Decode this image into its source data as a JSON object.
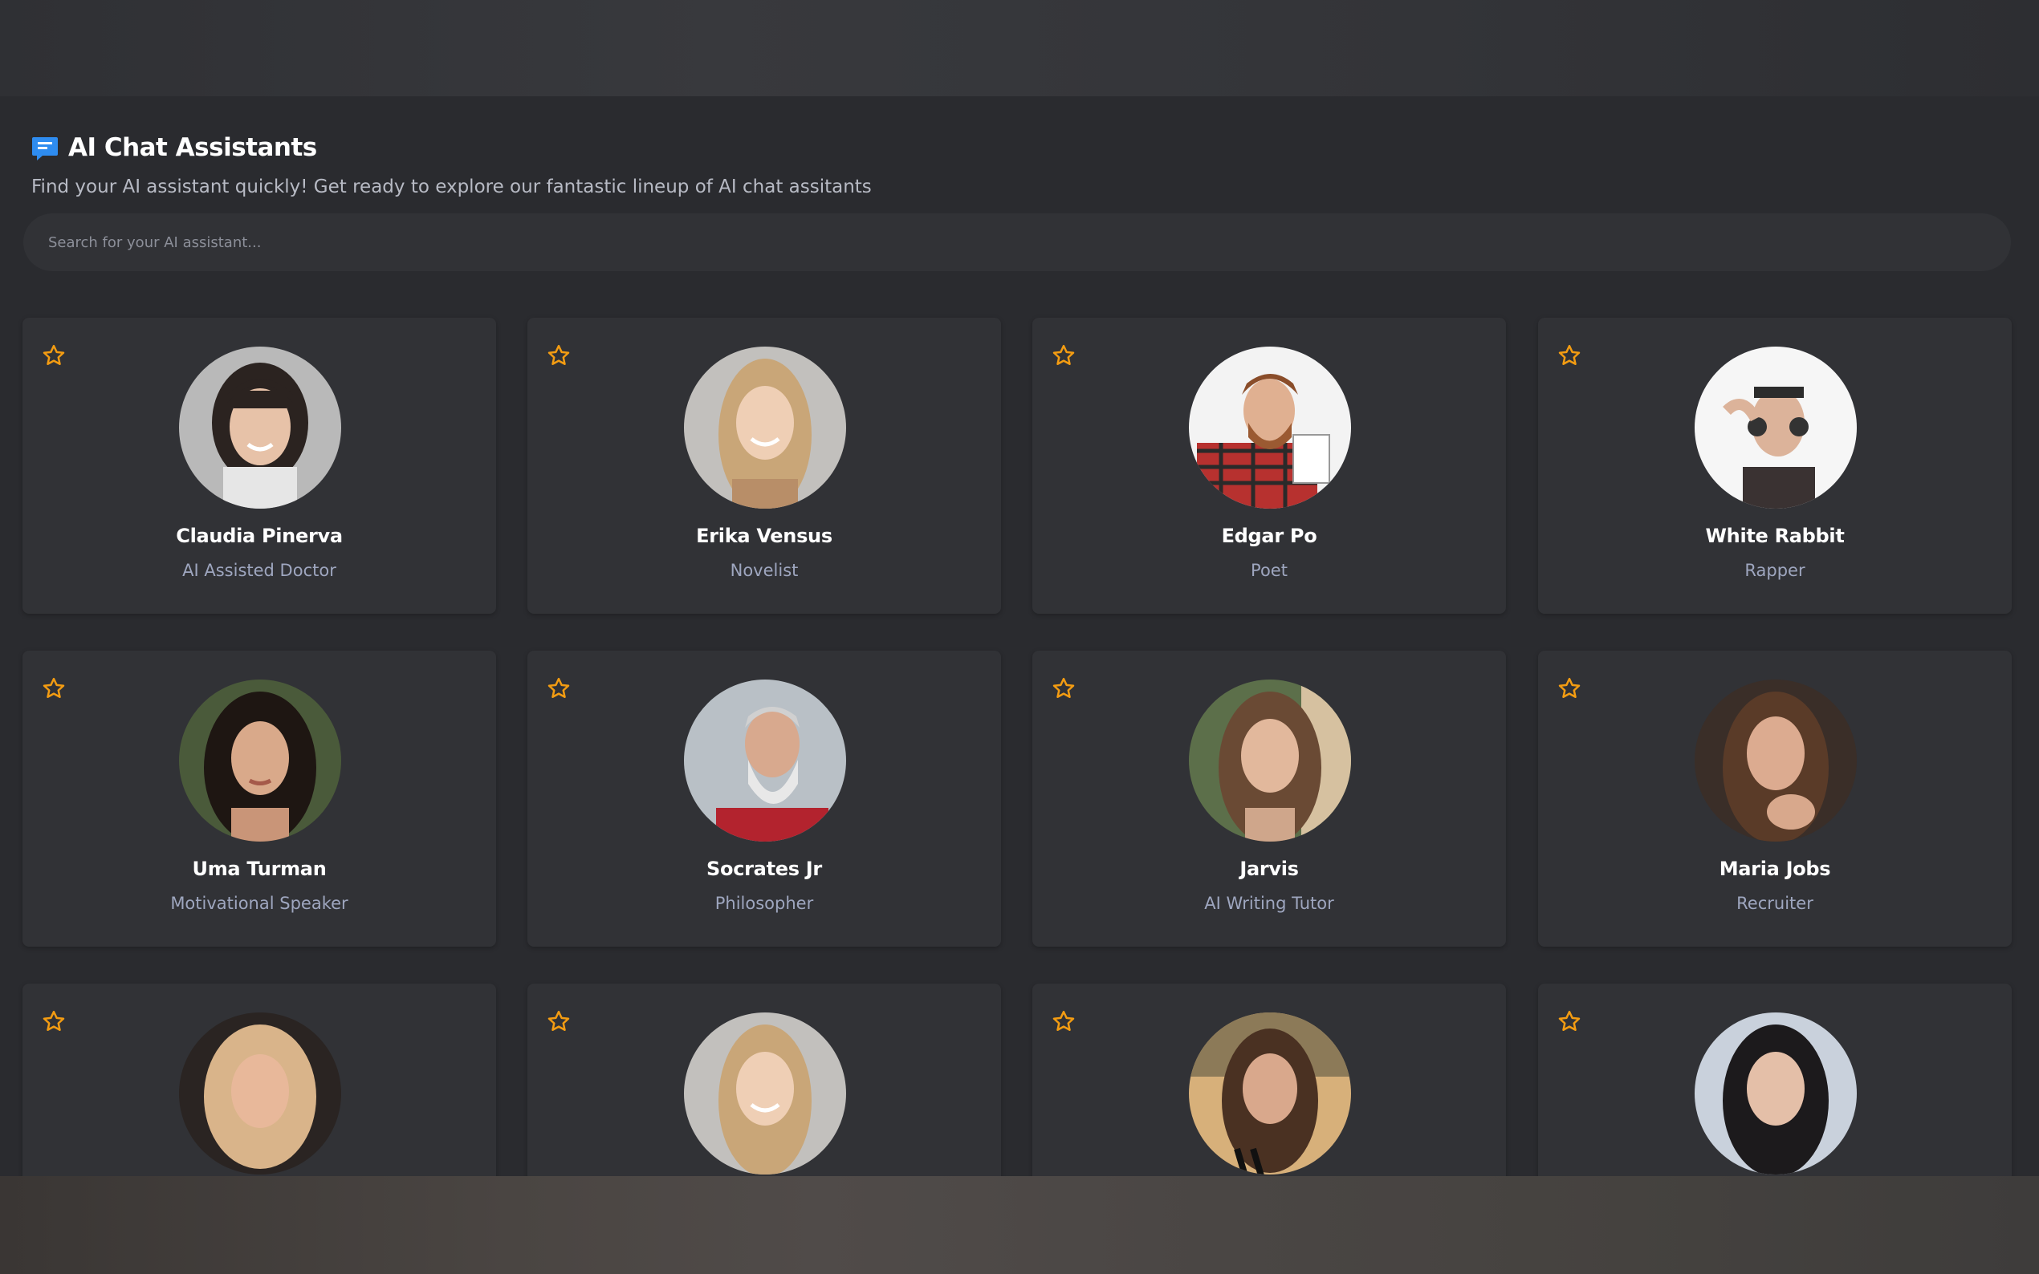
{
  "header": {
    "title": "AI Chat Assistants",
    "subtitle": "Find your AI assistant quickly! Get ready to explore our fantastic lineup of AI chat assitants"
  },
  "search": {
    "placeholder": "Search for your AI assistant..."
  },
  "colors": {
    "accent_star": "#f39c12",
    "icon_blue": "#2e8cf0"
  },
  "assistants": [
    {
      "name": "Claudia Pinerva",
      "role": "AI Assisted Doctor",
      "icon": "star-icon"
    },
    {
      "name": "Erika Vensus",
      "role": "Novelist",
      "icon": "star-icon"
    },
    {
      "name": "Edgar Po",
      "role": "Poet",
      "icon": "star-icon"
    },
    {
      "name": "White Rabbit",
      "role": "Rapper",
      "icon": "star-icon"
    },
    {
      "name": "Uma Turman",
      "role": "Motivational Speaker",
      "icon": "star-icon"
    },
    {
      "name": "Socrates Jr",
      "role": "Philosopher",
      "icon": "star-icon"
    },
    {
      "name": "Jarvis",
      "role": "AI Writing Tutor",
      "icon": "star-icon"
    },
    {
      "name": "Maria Jobs",
      "role": "Recruiter",
      "icon": "star-icon"
    },
    {
      "name": "",
      "role": "",
      "icon": "star-icon"
    },
    {
      "name": "",
      "role": "",
      "icon": "star-icon"
    },
    {
      "name": "",
      "role": "",
      "icon": "star-icon"
    },
    {
      "name": "",
      "role": "",
      "icon": "star-icon"
    }
  ]
}
